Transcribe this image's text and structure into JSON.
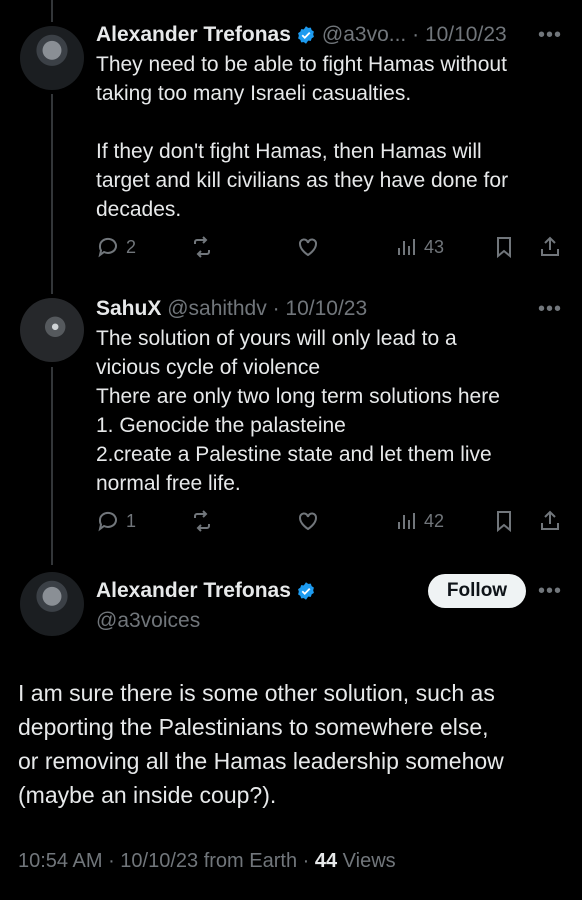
{
  "tweets": [
    {
      "name": "Alexander Trefonas",
      "handle": "@a3vo...",
      "date": "10/10/23",
      "lines": [
        "They need to be able to fight Hamas without",
        "taking too many Israeli casualties.",
        "",
        "If they don't fight Hamas, then Hamas will",
        "target and kill civilians as they have done for",
        "decades."
      ],
      "replies": "2",
      "views": "43"
    },
    {
      "name": "SahuX",
      "handle": "@sahithdv",
      "date": "10/10/23",
      "lines": [
        "The solution of yours will only lead to a",
        "vicious cycle of violence",
        "There are only two long term solutions here",
        "1. Genocide the palasteine",
        "2.create a Palestine state and let them live",
        "normal free life."
      ],
      "replies": "1",
      "views": "42"
    }
  ],
  "main": {
    "name": "Alexander Trefonas",
    "handle": "@a3voices",
    "follow_label": "Follow",
    "text_lines": [
      "I am sure there is some other solution, such as",
      "deporting the Palestinians to somewhere else,",
      "or removing all the Hamas leadership somehow",
      "(maybe an inside coup?)."
    ],
    "time": "10:54 AM",
    "date": "10/10/23",
    "source": "from Earth",
    "views_count": "44",
    "views_label": "Views"
  },
  "icons": {
    "verified": "verified-badge-icon",
    "reply": "reply-icon",
    "retweet": "retweet-icon",
    "like": "heart-icon",
    "views": "analytics-icon",
    "bookmark": "bookmark-icon",
    "share": "share-icon",
    "more": "more-icon"
  },
  "colors": {
    "background": "#000000",
    "text": "#e7e9ea",
    "muted": "#71767b",
    "verified": "#1d9bf0",
    "follow_bg": "#eff3f4"
  }
}
